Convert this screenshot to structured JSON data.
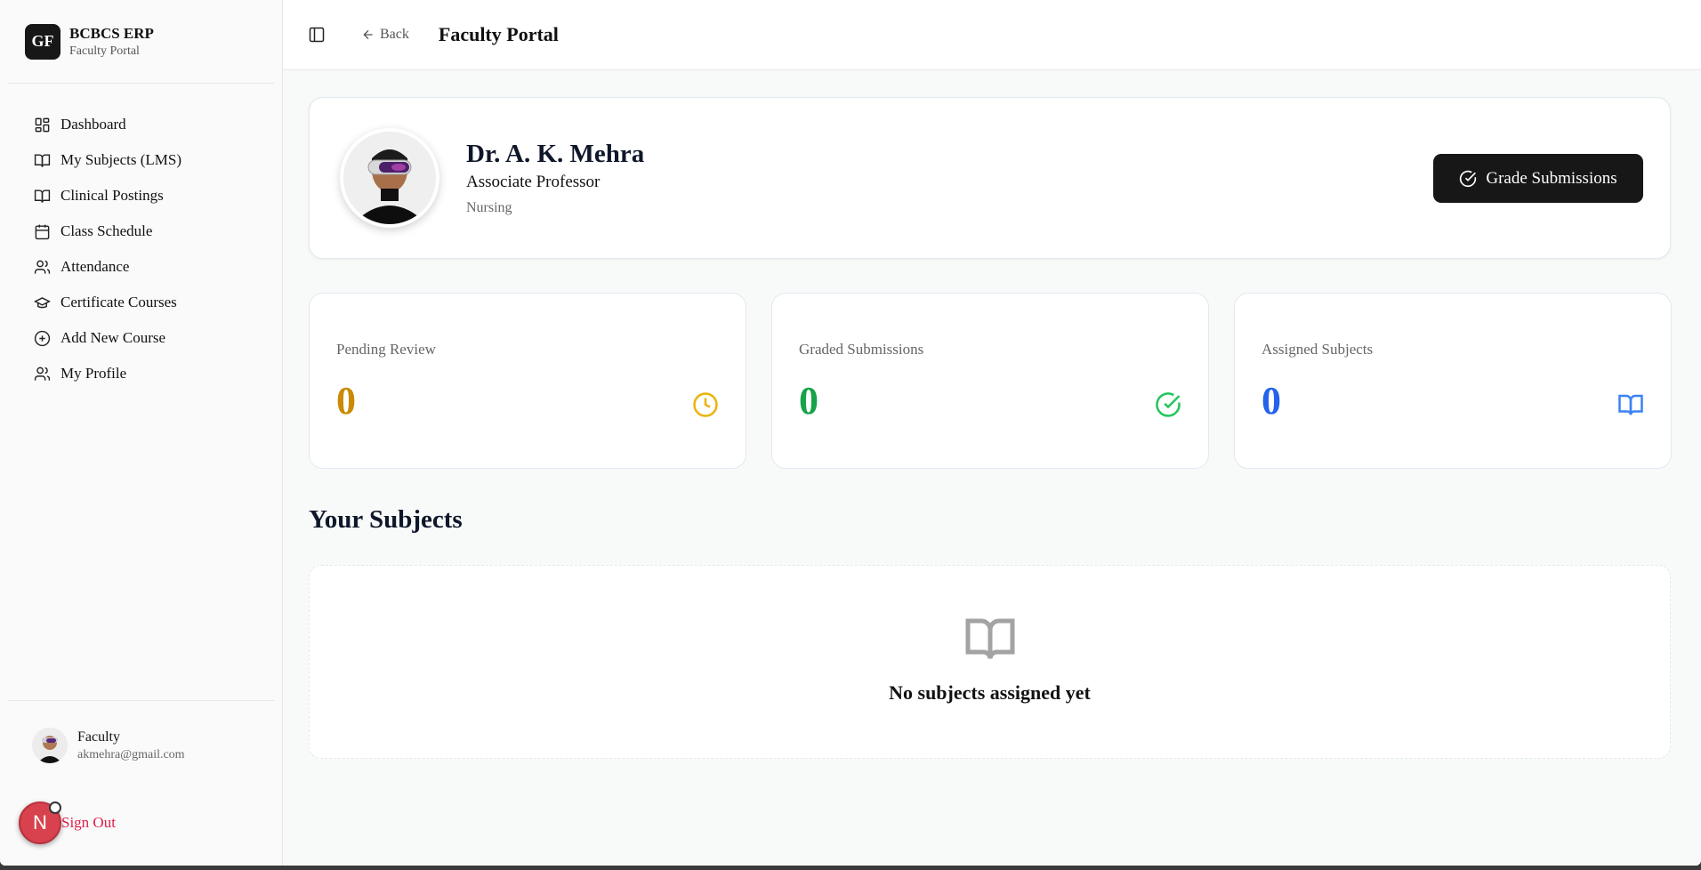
{
  "brand": {
    "logo": "GF",
    "title": "BCBCS ERP",
    "subtitle": "Faculty Portal"
  },
  "sidebar": {
    "items": [
      {
        "label": "Dashboard",
        "icon": "dashboard-icon"
      },
      {
        "label": "My Subjects (LMS)",
        "icon": "book-open-icon"
      },
      {
        "label": "Clinical Postings",
        "icon": "book-open-icon"
      },
      {
        "label": "Class Schedule",
        "icon": "calendar-icon"
      },
      {
        "label": "Attendance",
        "icon": "users-icon"
      },
      {
        "label": "Certificate Courses",
        "icon": "graduation-cap-icon"
      },
      {
        "label": "Add New Course",
        "icon": "plus-circle-icon"
      },
      {
        "label": "My Profile",
        "icon": "users-icon"
      }
    ]
  },
  "user": {
    "role": "Faculty",
    "email": "akmehra@gmail.com"
  },
  "signout": {
    "badge": "N",
    "label": "Sign Out"
  },
  "topbar": {
    "back_label": "Back",
    "title": "Faculty Portal"
  },
  "profile": {
    "name": "Dr. A. K. Mehra",
    "title": "Associate Professor",
    "department": "Nursing",
    "grade_button": "Grade Submissions"
  },
  "stats": [
    {
      "label": "Pending Review",
      "value": "0",
      "color": "#ca8a04",
      "icon": "clock-icon",
      "icon_color": "#eab308"
    },
    {
      "label": "Graded Submissions",
      "value": "0",
      "color": "#16a34a",
      "icon": "check-circle-icon",
      "icon_color": "#22c55e"
    },
    {
      "label": "Assigned Subjects",
      "value": "0",
      "color": "#2563eb",
      "icon": "book-open-icon",
      "icon_color": "#3b82f6"
    }
  ],
  "subjects": {
    "title": "Your Subjects",
    "empty_text": "No subjects assigned yet"
  }
}
